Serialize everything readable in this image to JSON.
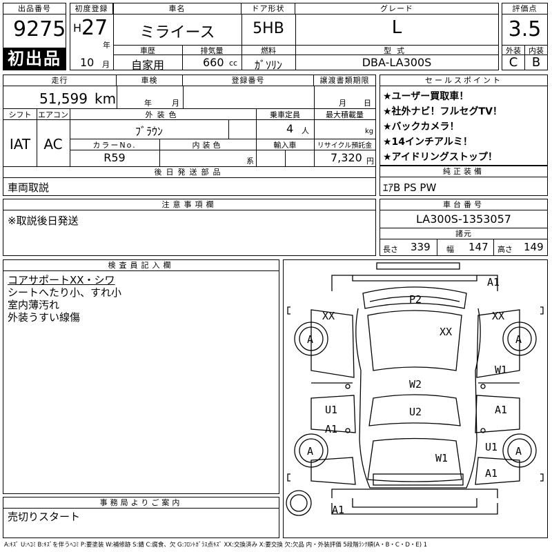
{
  "header": {
    "lot_label": "出品番号",
    "lot_number": "9275",
    "first_listing": "初出品",
    "reg_label": "初度登録",
    "era": "H",
    "year": "27",
    "year_unit": "年",
    "month": "10",
    "month_unit": "月",
    "name_label": "車名",
    "car_name": "ミライース",
    "door_label": "ドア形状",
    "door": "5HB",
    "grade_label": "グレード",
    "grade": "L",
    "score_label": "評価点",
    "score": "3.5",
    "history_label": "車歴",
    "history": "自家用",
    "disp_label": "排気量",
    "displacement": "660",
    "disp_unit": "cc",
    "fuel_label": "燃料",
    "fuel": "ｶﾞｿﾘﾝ",
    "model_label": "型式",
    "model": "DBA-LA300S",
    "ext_label": "外装",
    "ext_grade": "C",
    "int_label": "内装",
    "int_grade": "B"
  },
  "row2": {
    "mileage_label": "走行",
    "mileage": "51,599",
    "mileage_unit": "km",
    "inspection_label": "車検",
    "insp_year": "年",
    "insp_month": "月",
    "plate_label": "登録番号",
    "transfer_label": "譲渡書類期限",
    "tr_month": "月",
    "tr_day": "日",
    "shift_label": "シフト",
    "shift": "IAT",
    "ac_label": "エアコン",
    "ac": "AC",
    "color_label": "外装色",
    "color": "ﾌﾞﾗｳﾝ",
    "capacity_label": "乗車定員",
    "capacity": "4",
    "capacity_unit": "人",
    "load_label": "最大積載量",
    "load_unit": "kg",
    "colorno_label": "カラーNo.",
    "color_no": "R59",
    "intcolor_label": "内装色",
    "intcolor_unit": "系",
    "import_label": "輸入車",
    "recycle_label": "リサイクル預託金",
    "recycle": "7,320",
    "recycle_unit": "円",
    "later_label": "後日発送部品",
    "later": "車両取説"
  },
  "sales": {
    "label": "セールスポイント",
    "points": [
      "★ユーザー買取車！",
      "★社外ナビ！フルセグTV！",
      "★バックカメラ！",
      "★14インチアルミ！",
      "★アイドリングストップ！"
    ]
  },
  "equipment": {
    "label": "純正装備",
    "value": "ｴｱB PS PW"
  },
  "notes": {
    "label": "注意事項欄",
    "text": "※取説後日発送"
  },
  "chassis": {
    "label": "車台番号",
    "number": "LA300S-1353057",
    "dims_label": "諸元",
    "length_label": "長さ",
    "length": "339",
    "width_label": "幅",
    "width": "147",
    "height_label": "高さ",
    "height": "149"
  },
  "inspector": {
    "label": "検査員記入欄",
    "lines": [
      "コアサポートXX・シワ",
      "シートへたり小、すれ小",
      "室内薄汚れ",
      "外装うすい線傷"
    ]
  },
  "office": {
    "label": "事務局よりご案内",
    "text": "売切りスタート"
  },
  "map_codes": [
    "A1",
    "P2",
    "XX",
    "XX",
    "XX",
    "A",
    "A",
    "W1",
    "W2",
    "U1",
    "A1",
    "U2",
    "A1",
    "A",
    "A",
    "U1",
    "W1",
    "A1",
    "A1"
  ],
  "footer": "A:ｷｽﾞ U:ﾍｺﾐ B:ｷｽﾞを伴うﾍｺﾐ P:要塗装 W:補修跡 S:錆 C:腐食、欠 G:ﾌﾛﾝﾄｶﾞﾗｽ点ｷｽﾞ XX:交換済み X:要交換 欠:欠品 内・外装評価 5段階ﾗﾝｸ順(A・B・C・D・E) 1"
}
